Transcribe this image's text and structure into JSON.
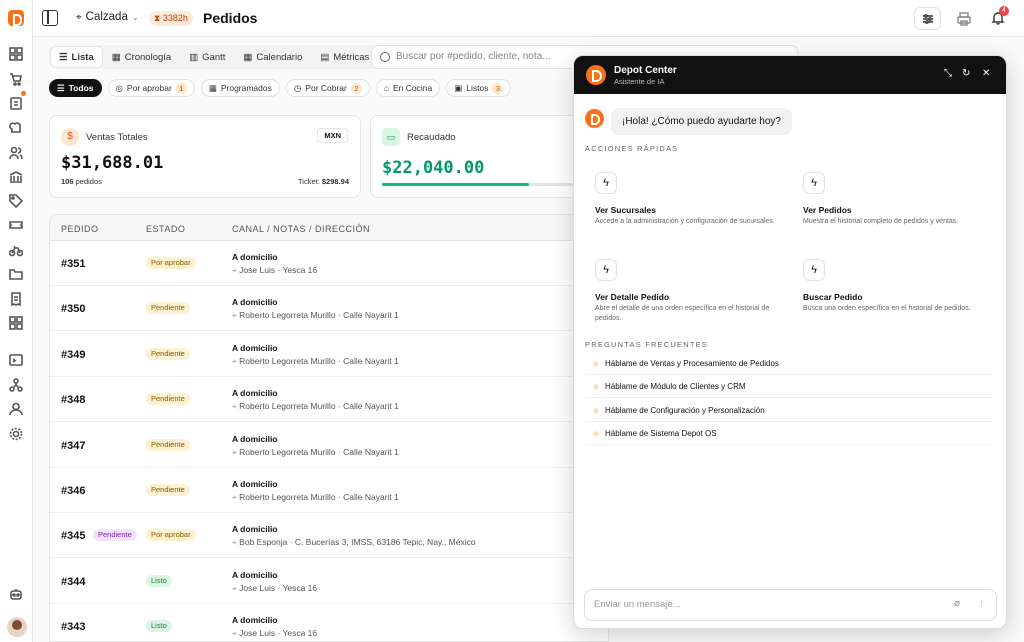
{
  "header": {
    "location": "Calzada",
    "hours": "3382h",
    "page_title": "Pedidos",
    "notifications": "4"
  },
  "views": [
    {
      "label": "Lista",
      "icon": "list-icon"
    },
    {
      "label": "Cronología",
      "icon": "calendar-icon"
    },
    {
      "label": "Gantt",
      "icon": "bar-icon"
    },
    {
      "label": "Calendario",
      "icon": "calendar-icon"
    },
    {
      "label": "Métricas",
      "icon": "chart-icon"
    }
  ],
  "search": {
    "placeholder": "Buscar por #pedido, cliente, nota..."
  },
  "filters": [
    {
      "label": "Todos",
      "count": ""
    },
    {
      "label": "Por aprobar",
      "count": "1"
    },
    {
      "label": "Programados",
      "count": ""
    },
    {
      "label": "Por Cobrar",
      "count": "2"
    },
    {
      "label": "En Cocina",
      "count": ""
    },
    {
      "label": "Listos",
      "count": "3"
    }
  ],
  "sales": {
    "label": "Ventas Totales",
    "currency": "MXN",
    "amount": "$31,688.01",
    "orders_count": "106",
    "orders_label": "pedidos",
    "ticket_label": "Ticket:",
    "ticket": "$298.94"
  },
  "collected": {
    "label": "Recaudado",
    "amount": "$22,040.00",
    "progress": 0.7
  },
  "table": {
    "headers": [
      "PEDIDO",
      "ESTADO",
      "CANAL / NOTAS / DIRECCIÓN"
    ],
    "rows": [
      {
        "id": "#351",
        "status": "Por aprobar",
        "status_kind": "o",
        "channel": "A domicilio",
        "address": "Jose Luis · Yesca 16"
      },
      {
        "id": "#350",
        "status": "Pendiente",
        "status_kind": "o",
        "channel": "A domicilio",
        "address": "Roberto Legorreta Murillo · Calle Nayarit 1"
      },
      {
        "id": "#349",
        "status": "Pendiente",
        "status_kind": "o",
        "channel": "A domicilio",
        "address": "Roberto Legorreta Murillo · Calle Nayarit 1"
      },
      {
        "id": "#348",
        "status": "Pendiente",
        "status_kind": "o",
        "channel": "A domicilio",
        "address": "Roberto Legorreta Murillo · Calle Nayarit 1"
      },
      {
        "id": "#347",
        "status": "Pendiente",
        "status_kind": "o",
        "channel": "A domicilio",
        "address": "Roberto Legorreta Murillo · Calle Nayarit 1"
      },
      {
        "id": "#346",
        "status": "Pendiente",
        "status_kind": "o",
        "channel": "A domicilio",
        "address": "Roberto Legorreta Murillo · Calle Nayarit 1"
      },
      {
        "id": "#345",
        "tag": "Pendiente",
        "status": "Por aprobar",
        "status_kind": "o",
        "channel": "A domicilio",
        "address": "Bob Esponja · C. Bucerías 3, IMSS, 63186 Tepic, Nay., México"
      },
      {
        "id": "#344",
        "status": "Listo",
        "status_kind": "g",
        "channel": "A domicilio",
        "address": "Jose Luis · Yesca 16"
      },
      {
        "id": "#343",
        "status": "Listo",
        "status_kind": "g",
        "channel": "A domicilio",
        "address": "Jose Luis · Yesca 16"
      }
    ]
  },
  "chat": {
    "title": "Depot Center",
    "subtitle": "Asistente de IA",
    "greeting": "¡Hola! ¿Cómo puedo ayudarte hoy?",
    "quick_title": "ACCIONES RÁPIDAS",
    "quick_actions": [
      {
        "title": "Ver Sucursales",
        "desc": "Accede a la administración y configuración de sucursales."
      },
      {
        "title": "Ver Pedidos",
        "desc": "Muestra el historial completo de pedidos y ventas."
      },
      {
        "title": "Ver Detalle Pedido",
        "desc": "Abre el detalle de una orden específica en el historial de pedidos."
      },
      {
        "title": "Buscar Pedido",
        "desc": "Busca una orden específica en el historial de pedidos."
      }
    ],
    "faq_title": "PREGUNTAS FRECUENTES",
    "faqs": [
      "Háblame de Ventas y Procesamiento de Pedidos",
      "Háblame de Módulo de Clientes y CRM",
      "Háblame de Configuración y Personalización",
      "Háblame de Sistema Depot OS"
    ],
    "input_placeholder": "Enviar un mensaje..."
  },
  "colors": {
    "accent": "#f97316",
    "money_green": "#059669"
  }
}
